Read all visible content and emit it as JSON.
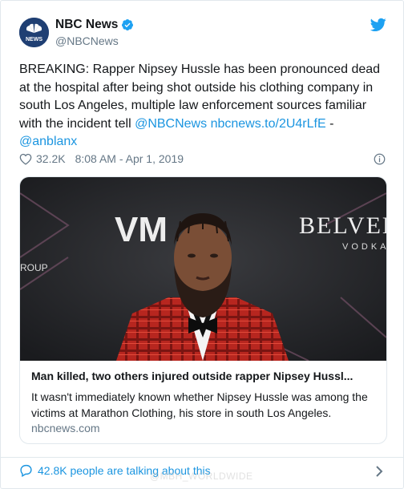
{
  "account": {
    "name": "NBC News",
    "handle": "@NBCNews",
    "avatar_label": "NEWS"
  },
  "tweet": {
    "text_before": "BREAKING: Rapper Nipsey Hussle has been pronounced dead at the hospital after being shot outside his clothing company in south Los Angeles, multiple law enforcement sources familiar with the incident tell ",
    "mention1": "@NBCNews",
    "link": "nbcnews.to/2U4rLfE",
    "separator": " - ",
    "mention2": "@anblanx",
    "likes": "32.2K",
    "timestamp": "8:08 AM - Apr 1, 2019"
  },
  "link_card": {
    "title": "Man killed, two others injured outside rapper Nipsey Hussl...",
    "description": "It wasn't immediately known whether Nipsey Hussle was among the victims at Marathon Clothing, his store in south Los Angeles.",
    "domain": "nbcnews.com",
    "photo_text": {
      "brand1": "VM",
      "brand2": "BELVED",
      "brand2_sub": "VODKA",
      "brand3": "ROUP"
    }
  },
  "footer": {
    "talking": "42.8K people are talking about this"
  },
  "watermark": "@MBH_WORLDWIDE",
  "colors": {
    "link_blue": "#1b95e0",
    "text": "#14171a",
    "muted": "#657786",
    "border": "#e1e8ed"
  },
  "icons": [
    "nbc-peacock-icon",
    "verified-badge-icon",
    "twitter-bird-icon",
    "heart-icon",
    "info-icon",
    "speech-bubble-icon",
    "chevron-right-icon"
  ]
}
